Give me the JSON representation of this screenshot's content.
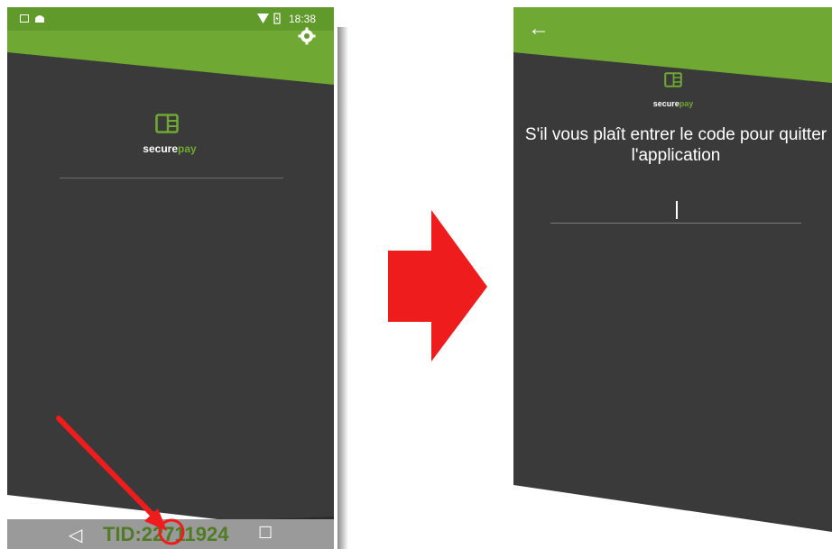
{
  "left_screen": {
    "status_bar": {
      "time": "18:38"
    },
    "brand": {
      "part1": "secure",
      "part2": "pay"
    },
    "nav_bar": {
      "tid_text": "TID:22711924",
      "back_glyph": "◁",
      "recent_glyph": "☐"
    },
    "icons": [
      "image-icon",
      "android-icon",
      "wifi-icon",
      "battery-icon",
      "gear-icon",
      "card-logo-icon"
    ]
  },
  "right_screen": {
    "back_glyph": "←",
    "brand": {
      "part1": "secure",
      "part2": "pay"
    },
    "prompt": "S'il vous plaît entrer le code pour quitter l'application",
    "code_input": {
      "value": "",
      "placeholder": ""
    }
  },
  "colors": {
    "accent_green": "#6fa832",
    "screen_background": "#3a3a3a",
    "tid_green": "#4f7c24",
    "annotation_red": "#ee1c1c"
  }
}
